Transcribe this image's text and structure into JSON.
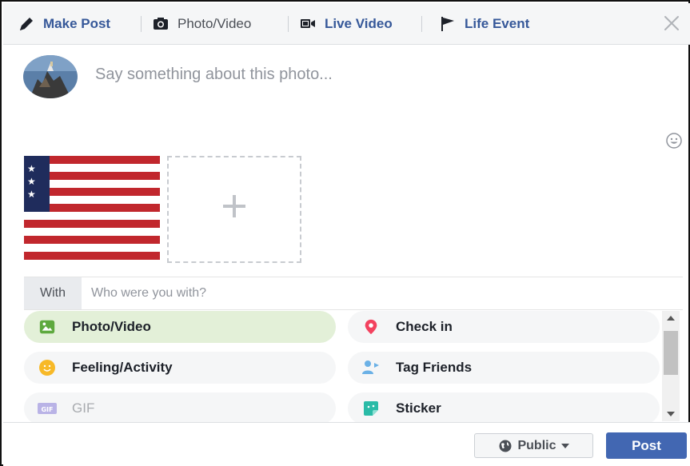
{
  "tabs": [
    {
      "label": "Make Post",
      "icon": "pencil-icon"
    },
    {
      "label": "Photo/Video",
      "icon": "camera-icon"
    },
    {
      "label": "Live Video",
      "icon": "live-video-icon"
    },
    {
      "label": "Life Event",
      "icon": "flag-icon"
    }
  ],
  "composer": {
    "placeholder": "Say something about this photo..."
  },
  "with": {
    "label": "With",
    "placeholder": "Who were you with?"
  },
  "options": [
    {
      "label": "Photo/Video",
      "icon": "photo-icon",
      "color": "#5ea93e"
    },
    {
      "label": "Check in",
      "icon": "map-pin-icon",
      "color": "#f3425f"
    },
    {
      "label": "Feeling/Activity",
      "icon": "smiley-icon",
      "color": "#f7b928"
    },
    {
      "label": "Tag Friends",
      "icon": "tag-friends-icon",
      "color": "#6bb1e6"
    },
    {
      "label": "GIF",
      "icon": "gif-icon",
      "color": "#9a8fd6"
    },
    {
      "label": "Sticker",
      "icon": "sticker-icon",
      "color": "#2abba7"
    }
  ],
  "footer": {
    "privacy_label": "Public",
    "post_label": "Post"
  },
  "colors": {
    "accent": "#4267b2",
    "link": "#365899",
    "selected_option": "#e3f0d8"
  }
}
